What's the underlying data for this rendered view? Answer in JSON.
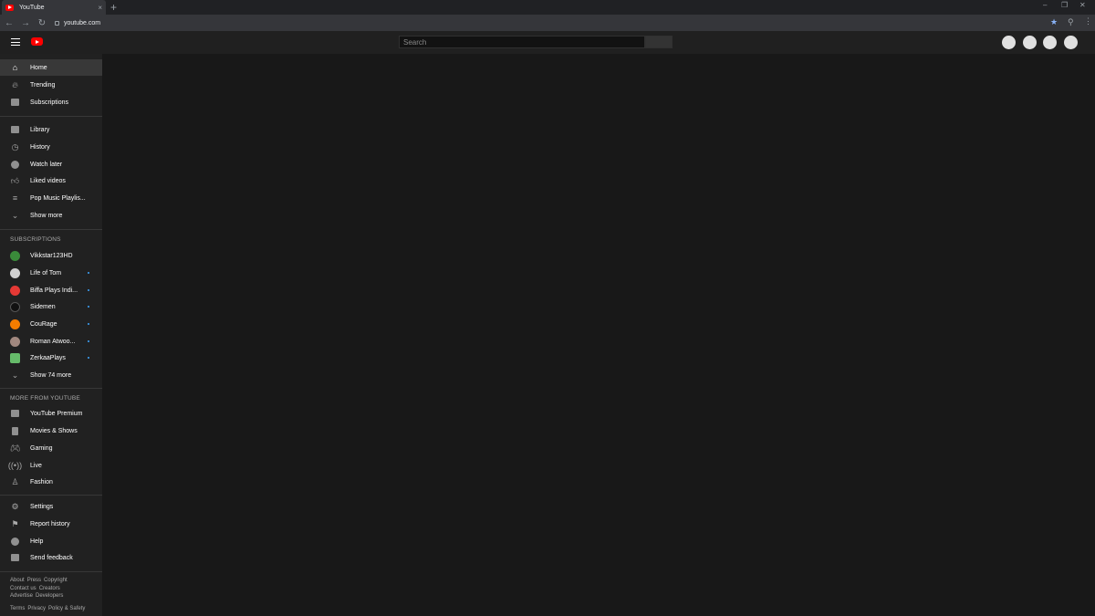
{
  "browser": {
    "tab_title": "YouTube",
    "tab_close": "×",
    "new_tab": "+",
    "url": "youtube.com",
    "back": "←",
    "forward": "→",
    "reload": "↻",
    "minimize": "–",
    "restore": "❐",
    "close": "✕"
  },
  "header": {
    "search_placeholder": "Search"
  },
  "sidebar": {
    "main_items": [
      {
        "label": "Home",
        "icon": "home-icon",
        "active": true
      },
      {
        "label": "Trending",
        "icon": "trending-icon"
      },
      {
        "label": "Subscriptions",
        "icon": "subscriptions-icon"
      }
    ],
    "library_items": [
      {
        "label": "Library",
        "icon": "library-icon"
      },
      {
        "label": "History",
        "icon": "history-icon"
      },
      {
        "label": "Watch later",
        "icon": "watch-later-icon"
      },
      {
        "label": "Liked videos",
        "icon": "thumbs-up-icon"
      },
      {
        "label": "Pop Music Playlis...",
        "icon": "playlist-icon"
      },
      {
        "label": "Show more",
        "icon": "chevron-down-icon"
      }
    ],
    "subscriptions_title": "SUBSCRIPTIONS",
    "subscriptions": [
      {
        "label": "Vikkstar123HD",
        "color": "#3a8a3a",
        "dot": false
      },
      {
        "label": "Life of Tom",
        "color": "#d0d0d0",
        "dot": true
      },
      {
        "label": "Biffa Plays Indi...",
        "color": "#e53935",
        "dot": true
      },
      {
        "label": "Sidemen",
        "color": "#111111",
        "dot": true
      },
      {
        "label": "CouRage",
        "color": "#f57c00",
        "dot": true
      },
      {
        "label": "Roman Atwoo...",
        "color": "#a1887f",
        "dot": true
      },
      {
        "label": "ZerkaaPlays",
        "color": "#66bb6a",
        "dot": true
      }
    ],
    "show_subs_more": "Show 74 more",
    "more_title": "MORE FROM YOUTUBE",
    "more_items": [
      {
        "label": "YouTube Premium",
        "icon": "youtube-premium-icon"
      },
      {
        "label": "Movies & Shows",
        "icon": "film-icon"
      },
      {
        "label": "Gaming",
        "icon": "gaming-icon"
      },
      {
        "label": "Live",
        "icon": "live-icon"
      },
      {
        "label": "Fashion",
        "icon": "fashion-icon"
      }
    ],
    "settings_items": [
      {
        "label": "Settings",
        "icon": "gear-icon"
      },
      {
        "label": "Report history",
        "icon": "flag-icon"
      },
      {
        "label": "Help",
        "icon": "help-icon"
      },
      {
        "label": "Send feedback",
        "icon": "feedback-icon"
      }
    ],
    "footer": {
      "row1": [
        "About",
        "Press",
        "Copyright"
      ],
      "row2": [
        "Contact us",
        "Creators"
      ],
      "row3": [
        "Advertise",
        "Developers"
      ],
      "row4": [
        "Terms",
        "Privacy",
        "Policy & Safety"
      ]
    }
  }
}
